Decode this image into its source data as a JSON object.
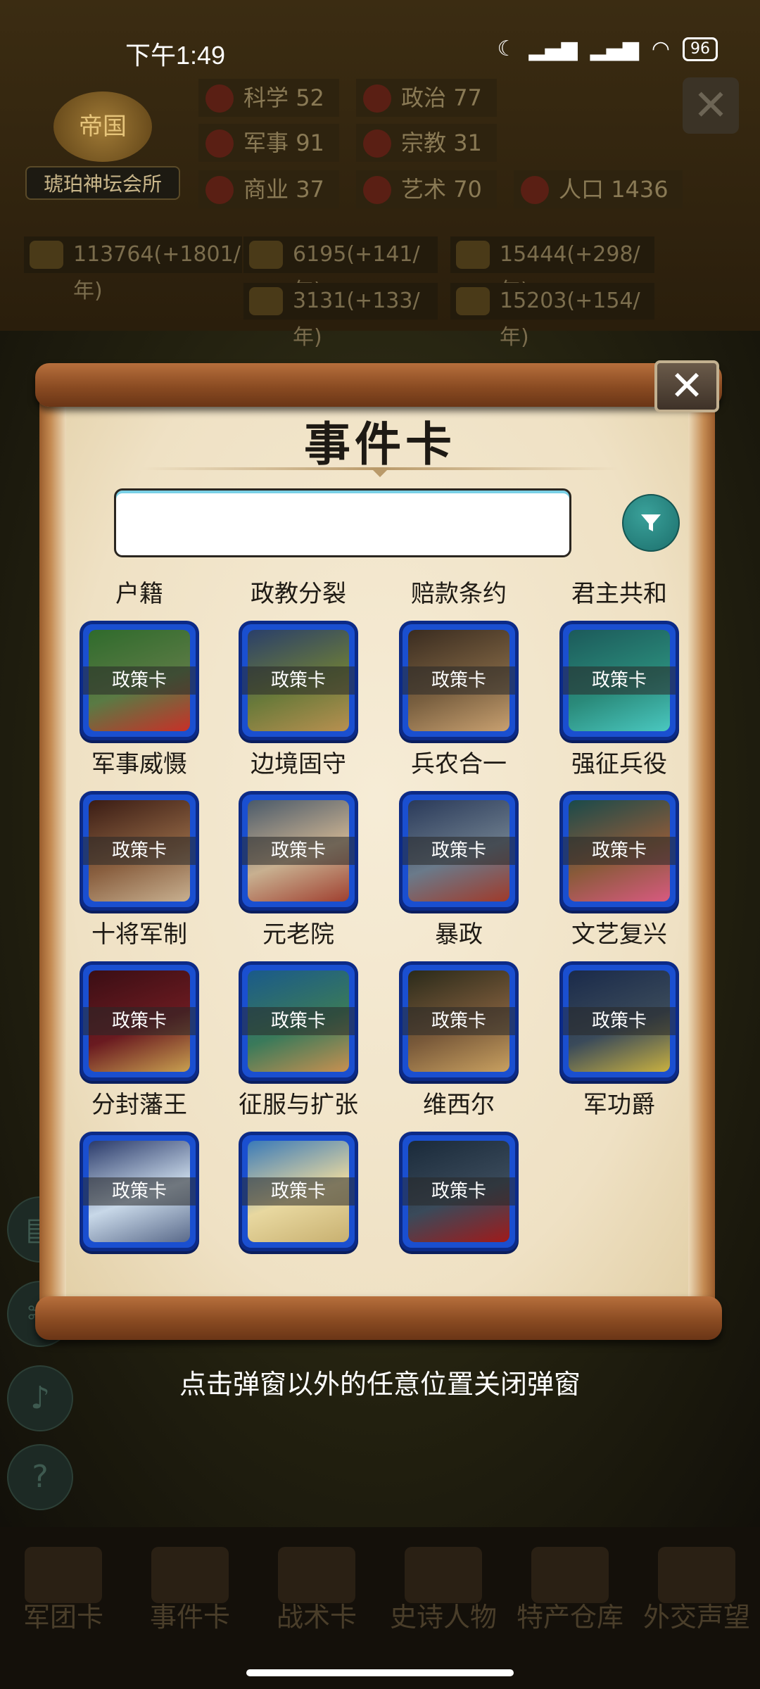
{
  "status_bar": {
    "time": "下午1:49",
    "battery": "96"
  },
  "header": {
    "empire_emblem_text": "帝国",
    "empire_name": "琥珀神坛会所",
    "stats": [
      {
        "label": "科学",
        "value": "52",
        "icon": "science-icon"
      },
      {
        "label": "政治",
        "value": "77",
        "icon": "politics-icon"
      },
      {
        "label": "军事",
        "value": "91",
        "icon": "military-icon"
      },
      {
        "label": "宗教",
        "value": "31",
        "icon": "religion-icon"
      },
      {
        "label": "商业",
        "value": "37",
        "icon": "commerce-icon"
      },
      {
        "label": "艺术",
        "value": "70",
        "icon": "art-icon"
      },
      {
        "label": "人口",
        "value": "1436",
        "icon": "population-icon"
      }
    ],
    "resources": [
      {
        "text": "113764(+1801/年)",
        "icon": "gold-icon"
      },
      {
        "text": "6195(+141/年)",
        "icon": "wood-icon"
      },
      {
        "text": "15444(+298/年)",
        "icon": "iron-icon"
      },
      {
        "text": "3131(+133/年)",
        "icon": "stone-icon"
      },
      {
        "text": "15203(+154/年)",
        "icon": "meat-icon"
      }
    ]
  },
  "modal": {
    "title": "事件卡",
    "search_placeholder": "",
    "search_value": "",
    "column_labels": [
      "户籍",
      "政教分裂",
      "赔款条约",
      "君主共和"
    ],
    "card_tag": "政策卡",
    "cards": [
      {
        "label": "军事威慑",
        "colors": [
          "#2f6b2c",
          "#5a7a44",
          "#c83028"
        ]
      },
      {
        "label": "边境固守",
        "colors": [
          "#2a3f6a",
          "#6a7a3a",
          "#b89050"
        ]
      },
      {
        "label": "兵农合一",
        "colors": [
          "#3a2c20",
          "#7a6040",
          "#c8a070"
        ]
      },
      {
        "label": "强征兵役",
        "colors": [
          "#1c5a5a",
          "#2a8a7a",
          "#4ac8c0"
        ]
      },
      {
        "label": "十将军制",
        "colors": [
          "#3a1c14",
          "#8a6040",
          "#c8b090"
        ]
      },
      {
        "label": "元老院",
        "colors": [
          "#4a5a6a",
          "#c8b090",
          "#a04030"
        ]
      },
      {
        "label": "暴政",
        "colors": [
          "#2a3a5a",
          "#6a7a8a",
          "#a03a2a"
        ]
      },
      {
        "label": "文艺复兴",
        "colors": [
          "#1a4a4a",
          "#8a5a3a",
          "#d85a80"
        ]
      },
      {
        "label": "分封藩王",
        "colors": [
          "#3a0e14",
          "#6a1a20",
          "#c8a050"
        ]
      },
      {
        "label": "征服与扩张",
        "colors": [
          "#1a5a8a",
          "#3a7a5a",
          "#c89050"
        ]
      },
      {
        "label": "维西尔",
        "colors": [
          "#2a2a1a",
          "#7a5a3a",
          "#c8a060"
        ]
      },
      {
        "label": "军功爵",
        "colors": [
          "#1a2a4a",
          "#3a4a5a",
          "#c8b040"
        ]
      },
      {
        "label": "",
        "colors": [
          "#2a3a6a",
          "#c8d8e8",
          "#5a6a8a"
        ]
      },
      {
        "label": "",
        "colors": [
          "#3a7ab8",
          "#e8d8a0",
          "#c8b070"
        ]
      },
      {
        "label": "",
        "colors": [
          "#1a2a3a",
          "#3a4a5a",
          "#a01a1a"
        ]
      }
    ]
  },
  "hint": "点击弹窗以外的任意位置关闭弹窗",
  "bottom_nav": [
    {
      "label": "军团卡"
    },
    {
      "label": "事件卡"
    },
    {
      "label": "战术卡"
    },
    {
      "label": "史诗人物"
    },
    {
      "label": "特产仓库"
    },
    {
      "label": "外交声望"
    }
  ]
}
